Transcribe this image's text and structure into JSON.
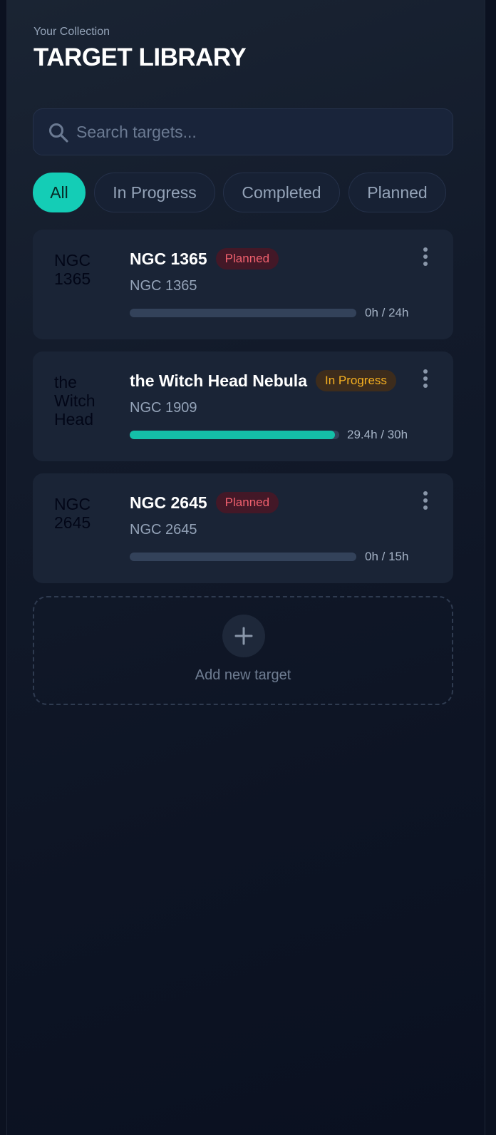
{
  "header": {
    "subtitle": "Your Collection",
    "title": "TARGET LIBRARY"
  },
  "search": {
    "placeholder": "Search targets...",
    "value": ""
  },
  "filters": [
    {
      "label": "All",
      "active": true
    },
    {
      "label": "In Progress",
      "active": false
    },
    {
      "label": "Completed",
      "active": false
    },
    {
      "label": "Planned",
      "active": false
    }
  ],
  "targets": [
    {
      "thumbnail_text": "NGC 1365",
      "name": "NGC 1365",
      "status": "Planned",
      "catalog": "NGC 1365",
      "hours_label": "0h / 24h",
      "progress": 0
    },
    {
      "thumbnail_text": "the Witch Head",
      "name": "the Witch Head Nebula",
      "status": "In Progress",
      "catalog": "NGC 1909",
      "hours_label": "29.4h / 30h",
      "progress": 0.98
    },
    {
      "thumbnail_text": "NGC 2645",
      "name": "NGC 2645",
      "status": "Planned",
      "catalog": "NGC 2645",
      "hours_label": "0h / 15h",
      "progress": 0
    }
  ],
  "add_target": {
    "label": "Add new target",
    "icon": "plus-icon"
  },
  "colors": {
    "accent": "#14cdb6",
    "planned": "#f0606e",
    "in_progress": "#f6b021"
  }
}
